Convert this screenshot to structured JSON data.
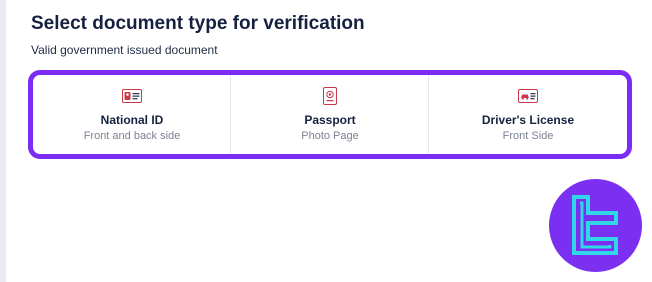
{
  "header": {
    "title": "Select document type for verification",
    "subtitle": "Valid government issued document"
  },
  "options": [
    {
      "label": "National ID",
      "sub": "Front and back side",
      "icon": "id-card-icon"
    },
    {
      "label": "Passport",
      "sub": "Photo Page",
      "icon": "passport-icon"
    },
    {
      "label": "Driver's License",
      "sub": "Front Side",
      "icon": "car-license-icon"
    }
  ],
  "colors": {
    "accent": "#7b2cf5",
    "title": "#16213f",
    "icon_red": "#c8374a",
    "logo_bg": "#7b2ff0",
    "logo_mark": "#2fd7e8"
  }
}
